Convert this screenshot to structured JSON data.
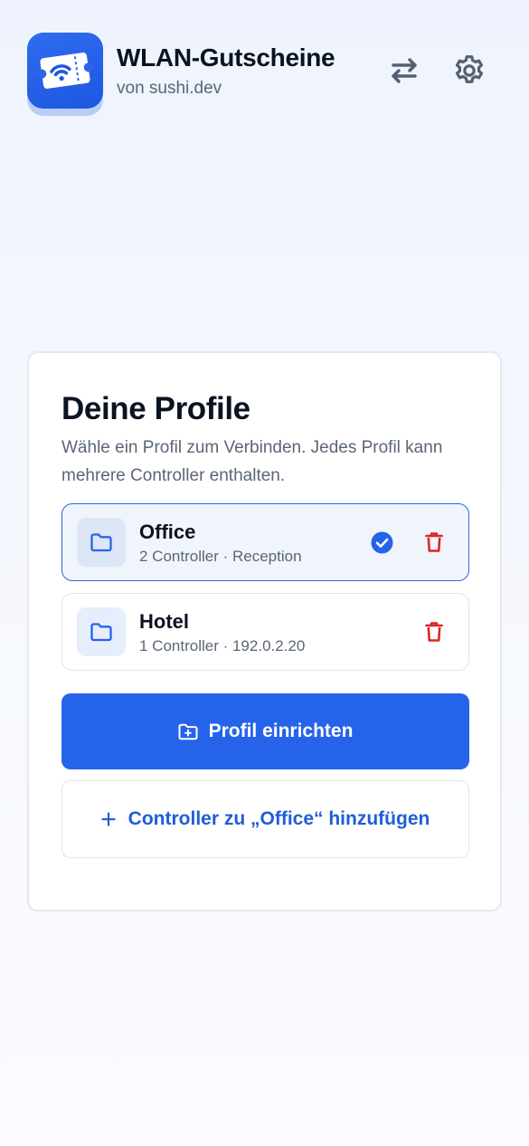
{
  "app": {
    "title": "WLAN-Gutscheine",
    "subtitle": "von sushi.dev",
    "icon": "wifi-ticket-icon",
    "brand_color": "#2563eb"
  },
  "header_actions": {
    "swap_icon": "swap-arrows-icon",
    "settings_icon": "gear-icon"
  },
  "profiles_card": {
    "title": "Deine Profile",
    "description": "Wähle ein Profil zum Verbinden. Jedes Profil kann mehrere Controller enthalten.",
    "profiles": [
      {
        "name": "Office",
        "meta": "2 Controller · Reception",
        "selected": true
      },
      {
        "name": "Hotel",
        "meta": "1 Controller · 192.0.2.20",
        "selected": false
      }
    ],
    "primary_button": "Profil einrichten",
    "secondary_button": "Controller zu „Office“ hinzufügen"
  },
  "colors": {
    "delete": "#dc2626",
    "selected_border": "#2f66d9",
    "link_text": "#1f5ed6"
  }
}
